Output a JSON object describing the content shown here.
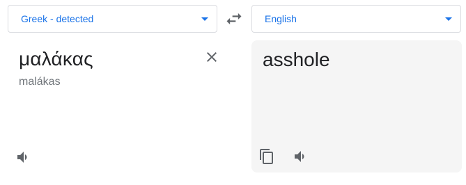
{
  "source_language": {
    "label": "Greek - detected"
  },
  "target_language": {
    "label": "English"
  },
  "source": {
    "text": "μαλάκας",
    "transliteration": "malákas"
  },
  "target": {
    "text": "asshole"
  },
  "icons": {
    "swap": "swap-horiz-icon",
    "clear": "close-icon",
    "listen_source": "volume-up-icon",
    "copy": "copy-icon",
    "listen_target": "volume-up-icon"
  },
  "colors": {
    "accent": "#1a73e8",
    "text": "#202124",
    "muted": "#70757a",
    "icon": "#5f6368",
    "target_panel_bg": "#f5f5f5"
  }
}
